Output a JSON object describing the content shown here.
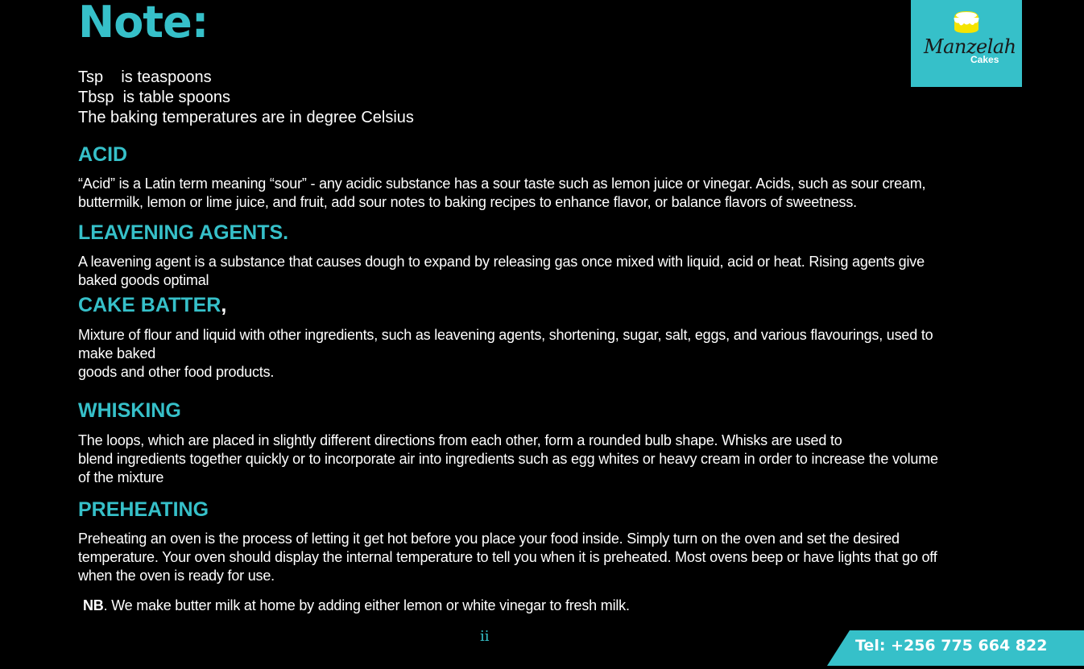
{
  "note_title": "Note:",
  "abbreviations": [
    "Tsp    is teaspoons",
    "Tbsp  is table spoons",
    "The baking temperatures are in degree Celsius"
  ],
  "sections": {
    "acid": {
      "heading": "ACID",
      "lines": [
        "“Acid” is a Latin term meaning “sour” - any acidic substance has a sour taste such as lemon juice or vinegar. Acids, such as sour cream,",
        "buttermilk, lemon or lime juice, and fruit, add sour notes to baking recipes to enhance flavor, or balance flavors of sweetness."
      ]
    },
    "leavening": {
      "heading": "LEAVENING AGENTS.",
      "lines": [
        "A leavening agent is a substance that causes dough to expand by releasing gas once mixed with liquid, acid or heat. Rising agents give",
        "baked goods optimal"
      ]
    },
    "cake_batter": {
      "heading": "CAKE BATTER",
      "heading_suffix": ",",
      "lines": [
        "Mixture of flour and liquid with other ingredients, such as leavening agents, shortening, sugar, salt, eggs, and various flavourings, used to",
        "make baked",
        "goods and other food products."
      ]
    },
    "whisking": {
      "heading": "WHISKING",
      "lines": [
        "The loops, which are placed in slightly different directions from each other, form a rounded bulb shape. Whisks are used to",
        "blend ingredients together quickly or to incorporate air into ingredients such as egg whites or heavy cream in order to  increase the volume",
        "of the mixture"
      ]
    },
    "preheating": {
      "heading": "PREHEATING",
      "lines": [
        "Preheating an oven is the process of letting it get hot before you place your food inside. Simply turn on the oven and set the desired",
        "temperature. Your oven should display the internal temperature to tell you when it is preheated. Most ovens beep or have lights that go off",
        "when the oven is ready for use."
      ]
    }
  },
  "nb": {
    "label": "NB",
    "text": ". We make butter milk at home by adding either lemon or white vinegar to fresh milk."
  },
  "page_number": "ii",
  "logo": {
    "name": "Manzelah",
    "sub": "Cakes"
  },
  "contact": {
    "tel": "Tel: +256 775 664 822"
  },
  "colors": {
    "accent": "#36c0c9",
    "background": "#000000",
    "text": "#ffffff"
  }
}
